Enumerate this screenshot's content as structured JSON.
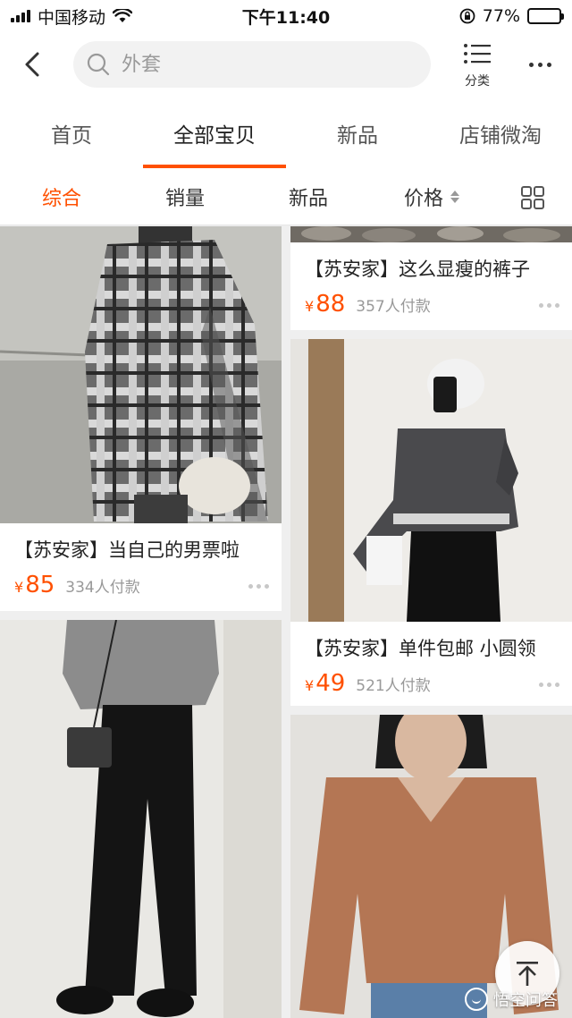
{
  "status_bar": {
    "carrier": "中国移动",
    "time": "下午11:40",
    "battery": "77%",
    "battery_level": 0.77
  },
  "header": {
    "search_placeholder": "外套",
    "category_label": "分类",
    "icons": {
      "back": "chevron-left-icon",
      "search": "search-icon",
      "category": "list-icon",
      "more": "more-dots-icon"
    }
  },
  "tabs": [
    {
      "label": "首页",
      "active": false
    },
    {
      "label": "全部宝贝",
      "active": true
    },
    {
      "label": "新品",
      "active": false
    },
    {
      "label": "店铺微淘",
      "active": false
    }
  ],
  "sort": {
    "items": [
      {
        "label": "综合",
        "active": true
      },
      {
        "label": "销量",
        "active": false
      },
      {
        "label": "新品",
        "active": false
      },
      {
        "label": "价格",
        "active": false
      }
    ],
    "grid_icon": "grid-view-icon"
  },
  "colors": {
    "accent": "#ff5000",
    "muted": "#999999"
  },
  "products": [
    {
      "title": "【苏安家】当自己的男票啦",
      "currency": "¥",
      "price": "85",
      "sold": "334人付款"
    },
    {
      "title": "【苏安家】这么显瘦的裤子",
      "currency": "¥",
      "price": "88",
      "sold": "357人付款"
    },
    {
      "title": "【苏安家】单件包邮 小圆领",
      "currency": "¥",
      "price": "49",
      "sold": "521人付款"
    },
    {
      "title": "",
      "currency": "",
      "price": "",
      "sold": ""
    },
    {
      "title": "",
      "currency": "",
      "price": "",
      "sold": ""
    }
  ],
  "watermark": {
    "text": "悟空问答"
  },
  "back_top_icon": "arrow-up-icon"
}
